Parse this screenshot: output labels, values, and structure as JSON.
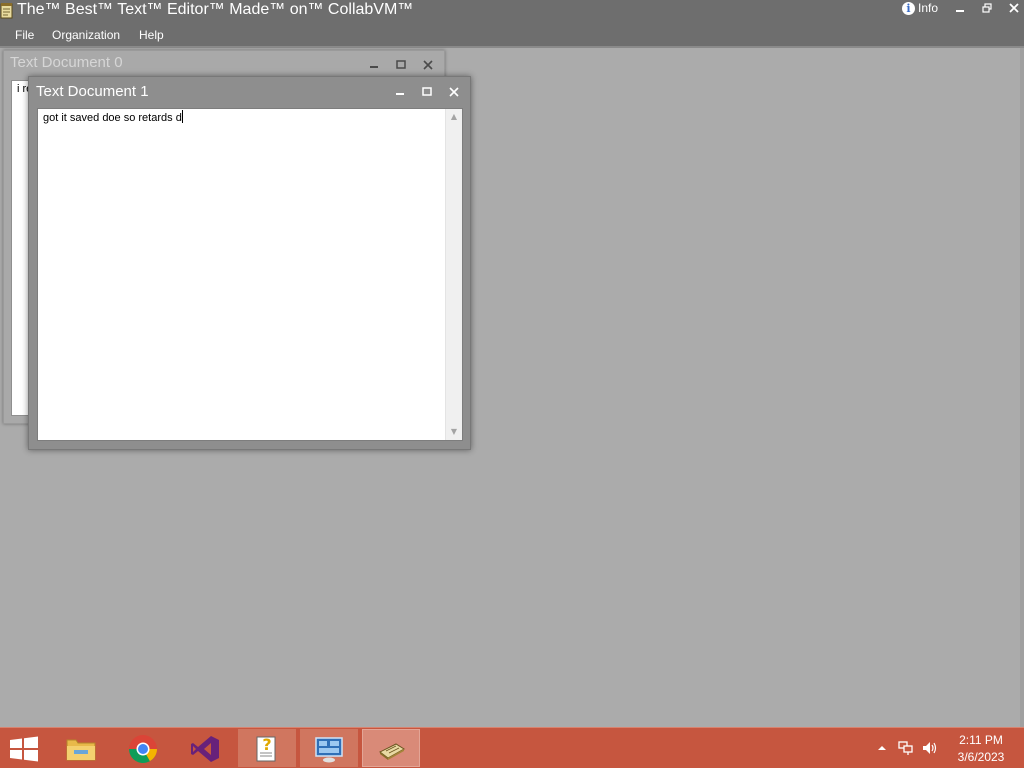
{
  "app": {
    "title": "The™ Best™ Text™ Editor™ Made™ on™ CollabVM™",
    "info_label": "Info",
    "controls": [
      "minimize",
      "restore",
      "close"
    ]
  },
  "menubar": {
    "items": [
      "File",
      "Organization",
      "Help"
    ]
  },
  "windows": [
    {
      "title": "Text Document 0",
      "content": "i re",
      "active": false
    },
    {
      "title": "Text Document 1",
      "content": "got it saved doe so retards d",
      "active": true
    }
  ],
  "taskbar": {
    "apps": [
      {
        "name": "File Explorer",
        "icon": "folder-icon"
      },
      {
        "name": "Google Chrome",
        "icon": "chrome-icon"
      },
      {
        "name": "Visual Studio",
        "icon": "visual-studio-icon"
      },
      {
        "name": "Help document",
        "icon": "help-doc-icon"
      },
      {
        "name": "Remote desktop",
        "icon": "monitor-icon"
      },
      {
        "name": "Text editor",
        "icon": "notepad-icon",
        "active": true
      }
    ],
    "tray": {
      "icons": [
        "show-hidden-icon",
        "network-icon",
        "volume-icon"
      ]
    },
    "clock": {
      "time": "2:11 PM",
      "date": "3/6/2023"
    }
  },
  "colors": {
    "titlebar": "#6e6e6e",
    "workspace": "#ababab",
    "taskbar": "#c6563f"
  }
}
